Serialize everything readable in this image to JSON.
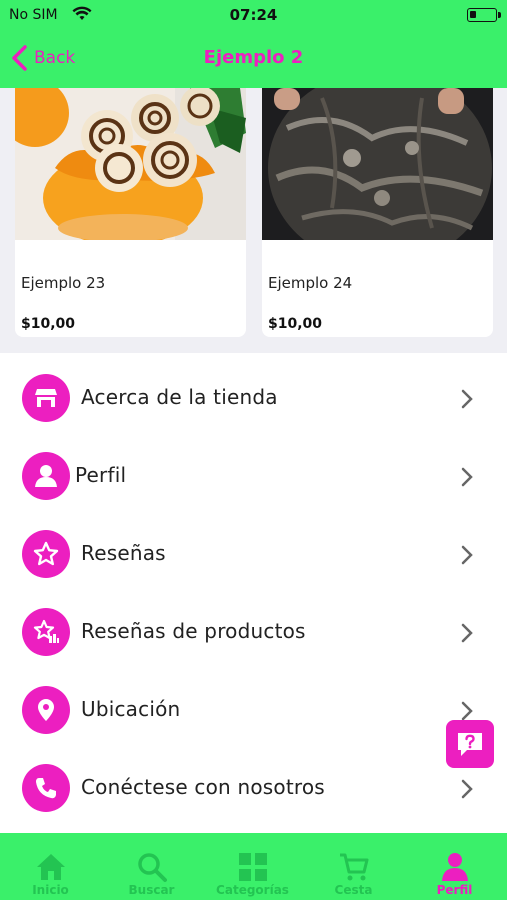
{
  "status": {
    "carrier": "No SIM",
    "time": "07:24"
  },
  "nav": {
    "back_label": "Back",
    "title": "Ejemplo 2"
  },
  "products": [
    {
      "name": "Ejemplo 23",
      "price": "$10,00"
    },
    {
      "name": "Ejemplo 24",
      "price": "$10,00"
    }
  ],
  "menu": [
    {
      "label": "Acerca de la tienda",
      "icon": "store-icon"
    },
    {
      "label": "Perfil",
      "icon": "person-icon"
    },
    {
      "label": "Reseñas",
      "icon": "star-icon"
    },
    {
      "label": "Reseñas de productos",
      "icon": "product-review-icon"
    },
    {
      "label": "Ubicación",
      "icon": "location-pin-icon"
    },
    {
      "label": "Conéctese con nosotros",
      "icon": "phone-icon"
    }
  ],
  "tabs": [
    {
      "label": "Inicio",
      "icon": "home-icon"
    },
    {
      "label": "Buscar",
      "icon": "search-icon"
    },
    {
      "label": "Categorías",
      "icon": "grid-icon"
    },
    {
      "label": "Cesta",
      "icon": "cart-icon"
    },
    {
      "label": "Perfil",
      "icon": "profile-icon",
      "active": true
    }
  ],
  "colors": {
    "accent": "#ec1fc0",
    "bar": "#3af06a",
    "tab_inactive": "#23c452"
  }
}
